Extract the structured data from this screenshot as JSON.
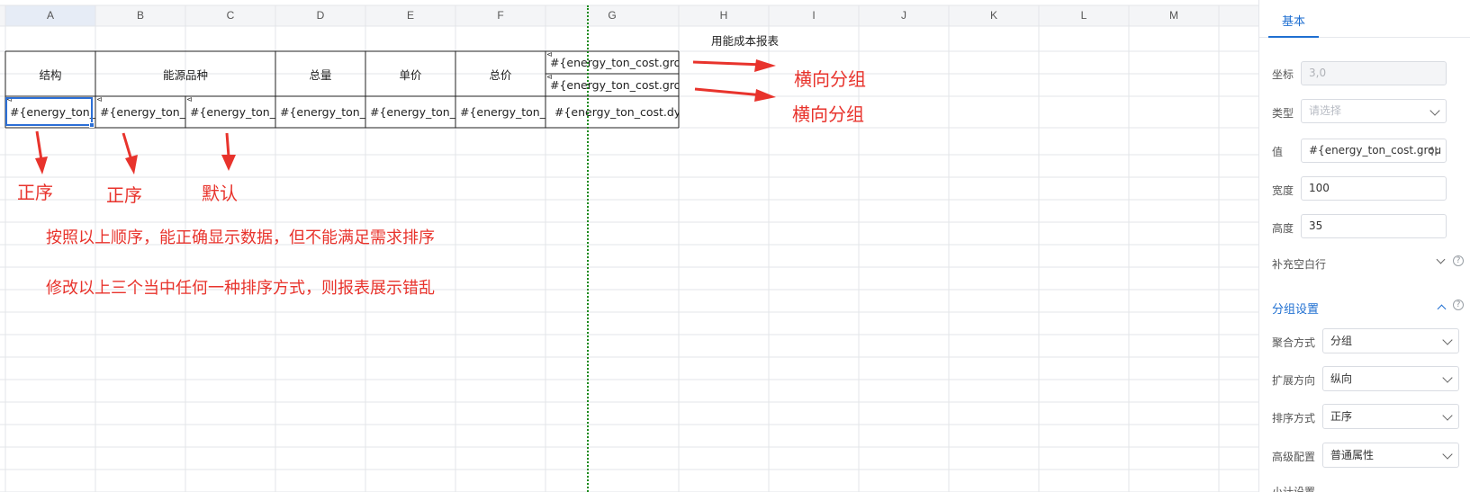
{
  "sheet": {
    "columns": [
      "A",
      "B",
      "C",
      "D",
      "E",
      "F",
      "G",
      "H",
      "I",
      "J",
      "K",
      "L",
      "M"
    ],
    "report_title": "用能成本报表",
    "headers": {
      "structure": "结构",
      "energy_type": "能源品种",
      "total_amount": "总量",
      "unit_price": "单价",
      "total_price": "总价",
      "group_row1": "#{energy_ton_cost.gro",
      "group_row2": "#{energy_ton_cost.gro"
    },
    "data_row": {
      "a": "#{energy_ton_",
      "b": "#{energy_ton_",
      "c": "#{energy_ton_",
      "d": "#{energy_ton_",
      "e": "#{energy_ton_",
      "f": "#{energy_ton_",
      "g": "#{energy_ton_cost.dy"
    },
    "annotations": {
      "horizontal_group_1": "横向分组",
      "horizontal_group_2": "横向分组",
      "order_a": "正序",
      "order_b": "正序",
      "order_c": "默认",
      "note_1": "按照以上顺序，能正确显示数据，但不能满足需求排序",
      "note_2": "修改以上三个当中任何一种排序方式，则报表展示错乱"
    }
  },
  "panel": {
    "tab_basic": "基本",
    "coordinate_label": "坐标",
    "coordinate_value": "3,0",
    "type_label": "类型",
    "type_placeholder": "请选择",
    "value_label": "值",
    "value_value": "#{energy_ton_cost.grou",
    "width_label": "宽度",
    "width_value": "100",
    "height_label": "高度",
    "height_value": "35",
    "fill_blank_label": "补充空白行",
    "group_settings_title": "分组设置",
    "aggregate_label": "聚合方式",
    "aggregate_value": "分组",
    "expand_dir_label": "扩展方向",
    "expand_dir_value": "纵向",
    "sort_label": "排序方式",
    "sort_value": "正序",
    "advanced_label": "高级配置",
    "advanced_value": "普通属性",
    "subtotal_label": "小计设置"
  },
  "colors": {
    "accent": "#1f6fd1",
    "annotation": "#e8332c",
    "selection": "#2c6fd6",
    "guide": "#1a8a1a"
  }
}
